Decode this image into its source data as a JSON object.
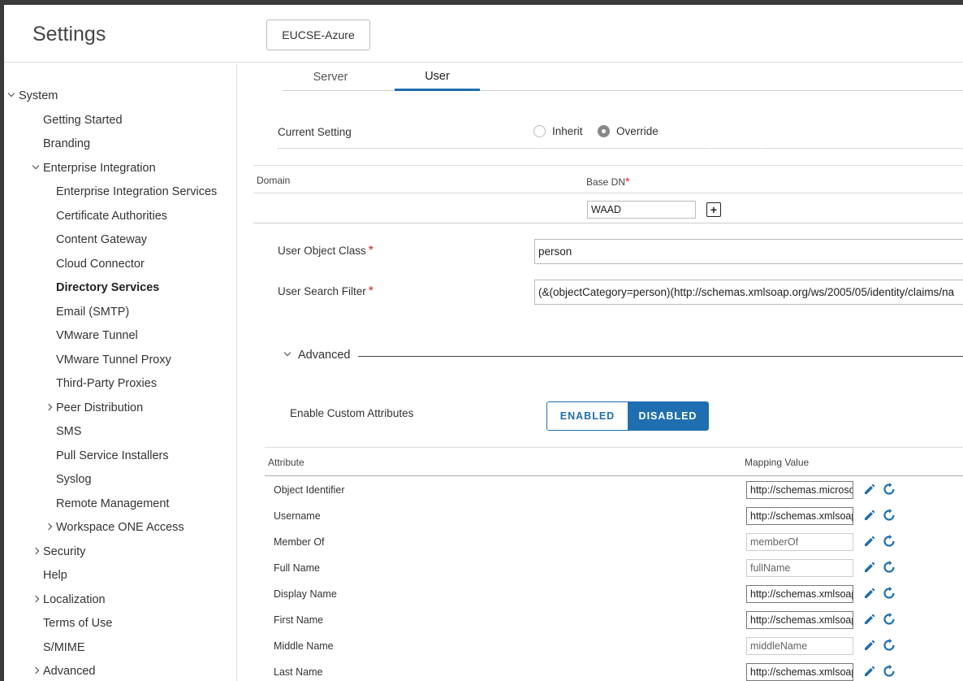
{
  "header": {
    "title": "Settings",
    "org_button": "EUCSE-Azure"
  },
  "sidebar": {
    "items": [
      {
        "label": "System",
        "indent": 0,
        "chevron": "down"
      },
      {
        "label": "Getting Started",
        "indent": 1,
        "chevron": ""
      },
      {
        "label": "Branding",
        "indent": 1,
        "chevron": ""
      },
      {
        "label": "Enterprise Integration",
        "indent": 1,
        "chevron": "down"
      },
      {
        "label": "Enterprise Integration Services",
        "indent": 2,
        "chevron": ""
      },
      {
        "label": "Certificate Authorities",
        "indent": 2,
        "chevron": ""
      },
      {
        "label": "Content Gateway",
        "indent": 2,
        "chevron": ""
      },
      {
        "label": "Cloud Connector",
        "indent": 2,
        "chevron": ""
      },
      {
        "label": "Directory Services",
        "indent": 2,
        "chevron": "",
        "active": true
      },
      {
        "label": "Email (SMTP)",
        "indent": 2,
        "chevron": ""
      },
      {
        "label": "VMware Tunnel",
        "indent": 2,
        "chevron": ""
      },
      {
        "label": "VMware Tunnel Proxy",
        "indent": 2,
        "chevron": ""
      },
      {
        "label": "Third-Party Proxies",
        "indent": 2,
        "chevron": ""
      },
      {
        "label": "Peer Distribution",
        "indent": 2,
        "chevron": "right"
      },
      {
        "label": "SMS",
        "indent": 2,
        "chevron": ""
      },
      {
        "label": "Pull Service Installers",
        "indent": 2,
        "chevron": ""
      },
      {
        "label": "Syslog",
        "indent": 2,
        "chevron": ""
      },
      {
        "label": "Remote Management",
        "indent": 2,
        "chevron": ""
      },
      {
        "label": "Workspace ONE Access",
        "indent": 2,
        "chevron": "right"
      },
      {
        "label": "Security",
        "indent": 1,
        "chevron": "right"
      },
      {
        "label": "Help",
        "indent": 1,
        "chevron": ""
      },
      {
        "label": "Localization",
        "indent": 1,
        "chevron": "right"
      },
      {
        "label": "Terms of Use",
        "indent": 1,
        "chevron": ""
      },
      {
        "label": "S/MIME",
        "indent": 1,
        "chevron": ""
      },
      {
        "label": "Advanced",
        "indent": 1,
        "chevron": "right"
      }
    ]
  },
  "tabs": [
    {
      "label": "Server",
      "active": false
    },
    {
      "label": "User",
      "active": true
    }
  ],
  "current_setting": {
    "label": "Current Setting",
    "options": [
      "Inherit",
      "Override"
    ],
    "selected": "Override"
  },
  "domain_table": {
    "col_domain": "Domain",
    "col_base_dn": "Base DN",
    "base_dn_value": "WAAD"
  },
  "user_object_class": {
    "label": "User Object Class",
    "value": "person"
  },
  "user_search_filter": {
    "label": "User Search Filter",
    "value": "(&(objectCategory=person)(http://schemas.xmlsoap.org/ws/2005/05/identity/claims/na"
  },
  "advanced": {
    "title": "Advanced",
    "custom_attrs_label": "Enable Custom Attributes",
    "enabled_label": "ENABLED",
    "disabled_label": "DISABLED",
    "selected": "DISABLED"
  },
  "attributes": {
    "col_attribute": "Attribute",
    "col_mapping": "Mapping Value",
    "rows": [
      {
        "name": "Object Identifier",
        "value": "http://schemas.microsoft",
        "editable": true
      },
      {
        "name": "Username",
        "value": "http://schemas.xmlsoap",
        "editable": true
      },
      {
        "name": "Member Of",
        "value": "memberOf",
        "editable": false
      },
      {
        "name": "Full Name",
        "value": "fullName",
        "editable": false
      },
      {
        "name": "Display Name",
        "value": "http://schemas.xmlsoap",
        "editable": true
      },
      {
        "name": "First Name",
        "value": "http://schemas.xmlsoap",
        "editable": true
      },
      {
        "name": "Middle Name",
        "value": "middleName",
        "editable": false
      },
      {
        "name": "Last Name",
        "value": "http://schemas.xmlsoap",
        "editable": true
      }
    ]
  },
  "colors": {
    "accent": "#1f6fb0",
    "required": "#dd2222"
  }
}
